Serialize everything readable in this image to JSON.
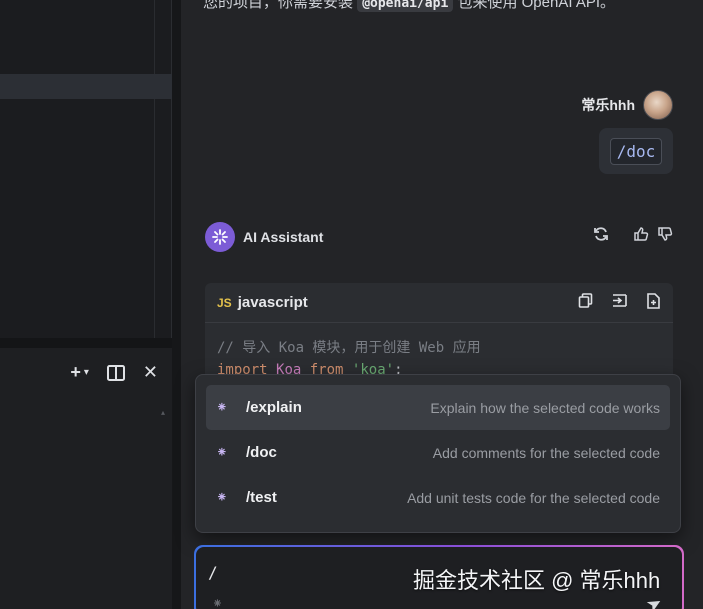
{
  "prev_message": {
    "before": "您的项目，你需要安装",
    "code": "@openai/api",
    "after": "包来使用 OpenAI API。"
  },
  "user": {
    "name": "常乐hhh",
    "command": "/doc"
  },
  "assistant": {
    "name": "AI Assistant"
  },
  "code_block": {
    "badge": "JS",
    "language": "javascript",
    "comment": "// 导入 Koa 模块，用于创建 Web 应用",
    "line2": {
      "kw1": "import",
      "id": "Koa",
      "kw2": "from",
      "str": "'koa'",
      "end": ";"
    }
  },
  "commands": [
    {
      "label": "/explain",
      "desc": "Explain how the selected code works",
      "active": true
    },
    {
      "label": "/doc",
      "desc": "Add comments for the selected code",
      "active": false
    },
    {
      "label": "/test",
      "desc": "Add unit tests code for the selected code",
      "active": false
    }
  ],
  "input": {
    "value": "/"
  },
  "watermark": "掘金技术社区 @ 常乐hhh",
  "icons": {
    "add": "plus-icon",
    "split": "split-view-icon",
    "close": "close-icon",
    "regenerate": "refresh-icon",
    "thumbs_up": "thumbs-up-icon",
    "thumbs_down": "thumbs-down-icon",
    "copy": "copy-icon",
    "insert": "insert-icon",
    "new_file": "new-file-icon",
    "command": "sparkle-icon",
    "send": "send-icon"
  },
  "colors": {
    "accent_start": "#3b6fe0",
    "accent_end": "#d36ac8",
    "ai_avatar": "#7c5cd6"
  }
}
